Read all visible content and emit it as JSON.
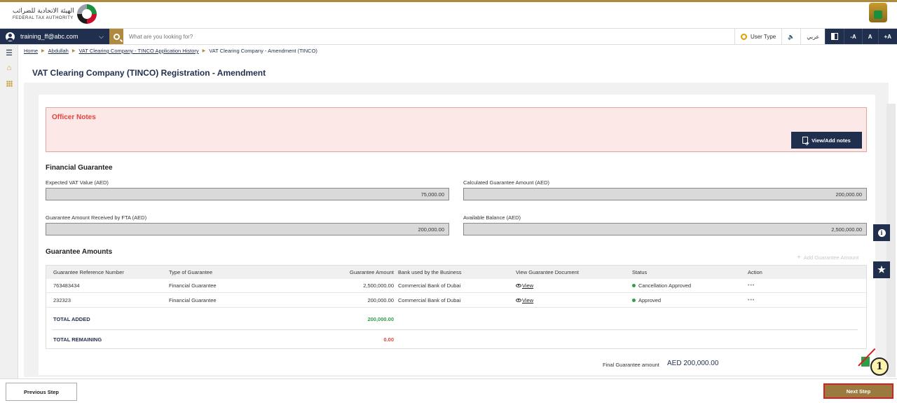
{
  "header": {
    "logo_arabic": "الهيئة الاتحادية للضرائب",
    "logo_english": "FEDERAL TAX AUTHORITY"
  },
  "topnav": {
    "user_email": "training_ff@abc.com",
    "search_placeholder": "What are you looking for?",
    "user_type": "User Type",
    "language": "عربي",
    "font_decrease": "-A",
    "font_normal": "A",
    "font_increase": "+A"
  },
  "breadcrumb": {
    "home": "Home",
    "user": "Abdullah",
    "history": "VAT Clearing Company - TINCO Application History",
    "current": "VAT Clearing Company - Amendment (TINCO)"
  },
  "page_title": "VAT Clearing Company (TINCO) Registration - Amendment",
  "officer_notes": {
    "title": "Officer Notes",
    "button": "View/Add notes"
  },
  "financial_guarantee": {
    "title": "Financial Guarantee",
    "expected_vat_label": "Expected VAT Value (AED)",
    "expected_vat_value": "75,000.00",
    "calculated_label": "Calculated Guarantee Amount (AED)",
    "calculated_value": "200,000.00",
    "received_label": "Guarantee Amount Received by FTA (AED)",
    "received_value": "200,000.00",
    "available_label": "Available Balance (AED)",
    "available_value": "2,500,000.00"
  },
  "guarantee_amounts": {
    "title": "Guarantee Amounts",
    "add_button": "Add Guarantee Amount",
    "columns": [
      "Guarantee Reference Number",
      "Type of Guarantee",
      "Guarantee Amount",
      "Bank used by the Business",
      "View Guarantee Document",
      "Status",
      "Action"
    ],
    "rows": [
      {
        "ref": "763483434",
        "type": "Financial Guarantee",
        "amount": "2,500,000.00",
        "bank": "Commercial Bank of Dubai",
        "view": "View",
        "status": "Cancellation Approved",
        "action": "•••"
      },
      {
        "ref": "232323",
        "type": "Financial Guarantee",
        "amount": "200,000.00",
        "bank": "Commercial Bank of Dubai",
        "view": "View",
        "status": "Approved",
        "action": "•••"
      }
    ],
    "total_added_label": "TOTAL ADDED",
    "total_added_value": "200,000.00",
    "total_remaining_label": "TOTAL REMAINING",
    "total_remaining_value": "0.00"
  },
  "final_guarantee": {
    "label": "Final Guarantee amount",
    "value": "AED 200,000.00"
  },
  "footer": {
    "previous": "Previous Step",
    "next": "Next Step"
  },
  "callout": "1",
  "colors": {
    "navy": "#1f2f4d",
    "gold": "#b08a3e",
    "notes_red": "#e2443b",
    "status_green": "#2e9e4a",
    "highlight_red": "#d42020"
  }
}
